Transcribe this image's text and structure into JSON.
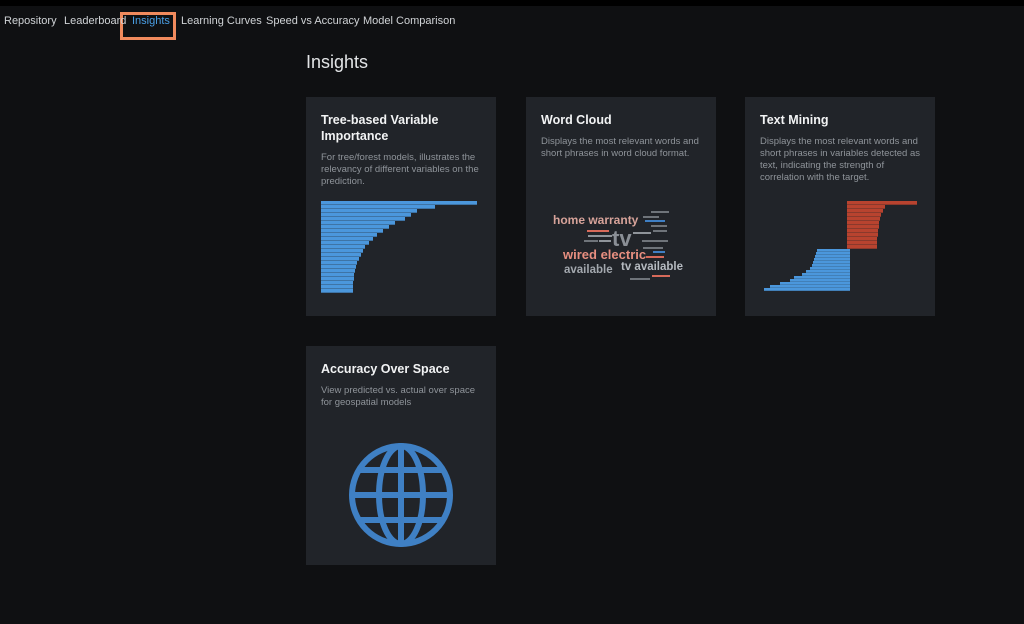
{
  "nav": {
    "tabs": [
      {
        "label": "Repository"
      },
      {
        "label": "Leaderboard"
      },
      {
        "label": "Insights"
      },
      {
        "label": "Learning Curves"
      },
      {
        "label": "Speed vs Accuracy"
      },
      {
        "label": "Model Comparison"
      }
    ],
    "active_tab": "Insights"
  },
  "page": {
    "title": "Insights"
  },
  "cards": [
    {
      "title": "Tree-based Variable Importance",
      "description": "For tree/forest models, illustrates the relevancy of different variables on the prediction."
    },
    {
      "title": "Word Cloud",
      "description": "Displays the most relevant words and short phrases in word cloud format."
    },
    {
      "title": "Text Mining",
      "description": "Displays the most relevant words and short phrases in variables detected as text, indicating the strength of correlation with the target."
    },
    {
      "title": "Accuracy Over Space",
      "description": "View predicted vs. actual over space for geospatial models"
    }
  ],
  "word_cloud": {
    "words": [
      "home warranty",
      "tv",
      "wired electric",
      "available",
      "tv available"
    ]
  },
  "colors": {
    "accent_blue": "#4a9fe6",
    "bar_blue": "#4b97dc",
    "text_mining_red": "#b8432f",
    "highlight_orange": "#f08a5d",
    "card_bg": "#212429"
  }
}
